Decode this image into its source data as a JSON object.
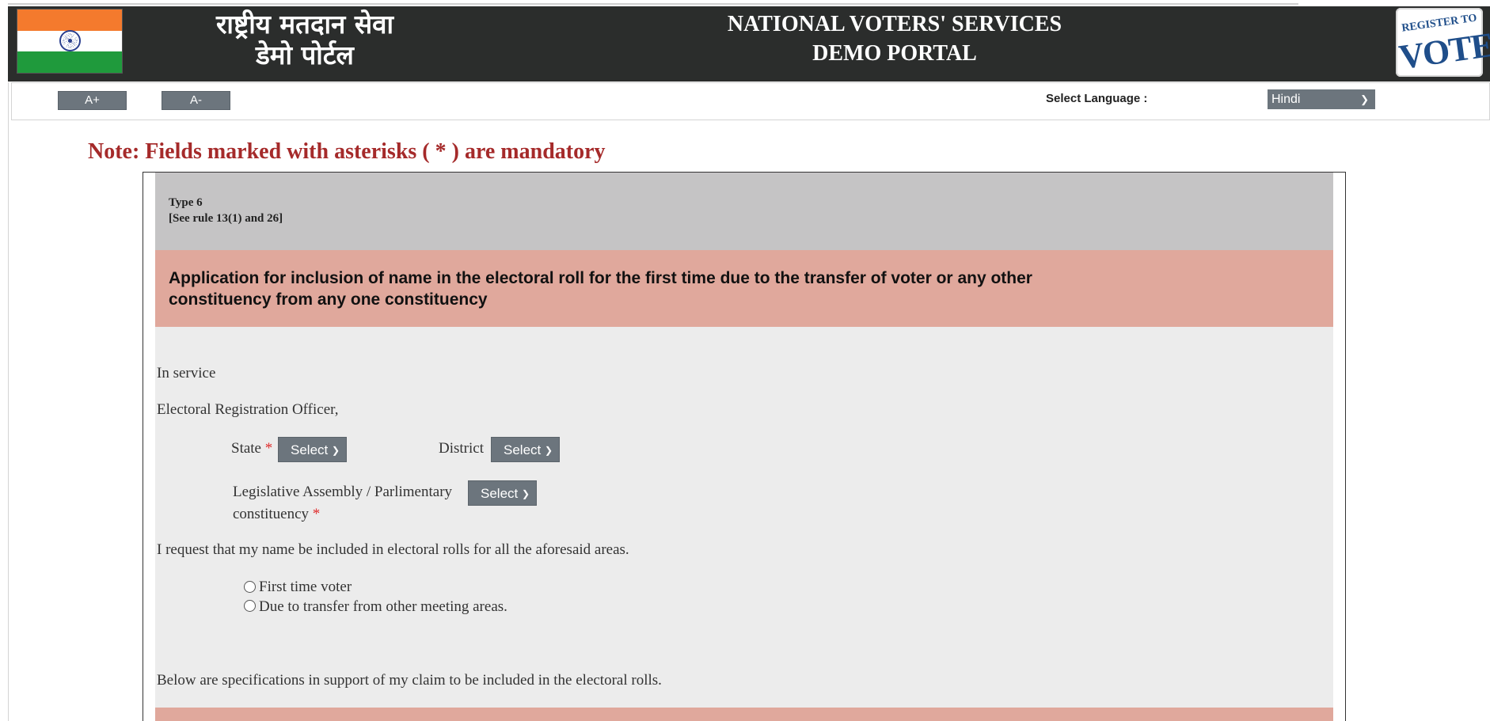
{
  "header": {
    "hindi_title_line1": "राष्ट्रीय मतदान सेवा",
    "hindi_title_line2": "डेमो पोर्टल",
    "english_title_line1": "NATIONAL VOTERS' SERVICES",
    "english_title_line2": "DEMO PORTAL",
    "logo_small_text": "REGISTER TO",
    "logo_big_text": "VOTE"
  },
  "toolbar": {
    "font_increase_label": "A+",
    "font_decrease_label": "A-",
    "language_label": "Select Language :",
    "language_selected": "Hindi"
  },
  "note": "Note: Fields marked with asterisks ( * ) are mandatory",
  "form": {
    "type_line1": "Type 6",
    "type_line2": "[See rule 13(1) and 26]",
    "application_title": "Application for inclusion of name in the electoral roll for the first time due to the transfer of voter or any other constituency from any one constituency",
    "in_service": "In service",
    "officer": "Electoral Registration Officer,",
    "state_label": "State",
    "state_select": "Select",
    "district_label": "District",
    "district_select": "Select",
    "constituency_label_line1": "Legislative Assembly / Parlimentary",
    "constituency_label_line2": "constituency",
    "constituency_select": "Select",
    "required_mark": "*",
    "request_text": "I request that my name be included in electoral rolls for all the aforesaid areas.",
    "radio_first_time": "First time voter",
    "radio_transfer": "Due to transfer from other meeting areas.",
    "specifications_text": "Below are specifications in support of my claim to be included in the electoral rolls."
  },
  "colors": {
    "header_bg": "#2b2d2c",
    "note_color": "#a52a2a",
    "select_bg": "#6c757d",
    "section_pink": "#e0a89c",
    "section_grey": "#c5c4c5",
    "form_bg": "#ececec"
  }
}
